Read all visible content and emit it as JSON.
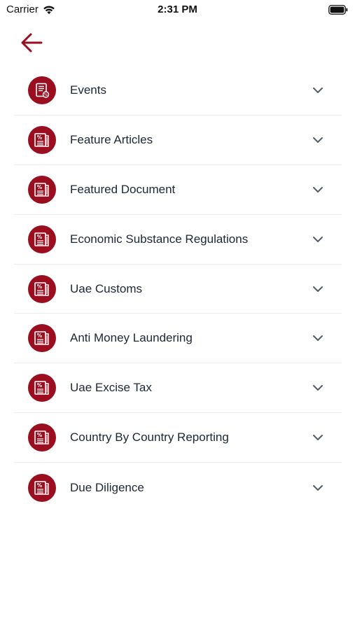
{
  "status_bar": {
    "carrier": "Carrier",
    "time": "2:31 PM"
  },
  "colors": {
    "accent": "#9b0e20",
    "text": "#202836",
    "chevron": "#555c66",
    "divider": "#ececec"
  },
  "icons": {
    "back": "arrow-left-icon",
    "events": "document-icon",
    "category": "newspaper-percent-icon",
    "expand": "chevron-down-icon"
  },
  "categories": [
    {
      "label": "Events"
    },
    {
      "label": "Feature Articles"
    },
    {
      "label": "Featured Document"
    },
    {
      "label": "Economic Substance Regulations"
    },
    {
      "label": "Uae Customs"
    },
    {
      "label": "Anti Money Laundering"
    },
    {
      "label": "Uae Excise Tax"
    },
    {
      "label": "Country By Country Reporting"
    },
    {
      "label": "Due Diligence"
    }
  ]
}
